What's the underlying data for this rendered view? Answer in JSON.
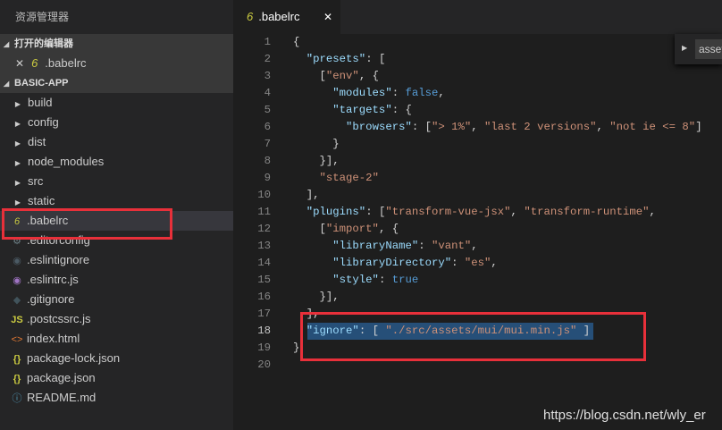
{
  "sidebar": {
    "title": "资源管理器",
    "open_editors": {
      "label": "打开的编辑器",
      "items": [
        {
          "name": ".babelrc",
          "icon": "babel-icon"
        }
      ]
    },
    "project": {
      "label": "BASIC-APP",
      "folders": [
        "build",
        "config",
        "dist",
        "node_modules",
        "src",
        "static"
      ],
      "files": [
        {
          "name": ".babelrc",
          "icon": "babel-icon",
          "color": "#cbcb41",
          "glyph": "6"
        },
        {
          "name": ".editorconfig",
          "icon": "gear-icon",
          "color": "#6d8086",
          "glyph": "⚙"
        },
        {
          "name": ".eslintignore",
          "icon": "eslint-icon",
          "color": "#4b5a64",
          "glyph": "◉"
        },
        {
          "name": ".eslintrc.js",
          "icon": "eslint-icon",
          "color": "#a074c4",
          "glyph": "◉"
        },
        {
          "name": ".gitignore",
          "icon": "git-icon",
          "color": "#41535b",
          "glyph": "◆"
        },
        {
          "name": ".postcssrc.js",
          "icon": "js-icon",
          "color": "#cbcb41",
          "glyph": "JS"
        },
        {
          "name": "index.html",
          "icon": "html-icon",
          "color": "#e37933",
          "glyph": "<>"
        },
        {
          "name": "package-lock.json",
          "icon": "json-icon",
          "color": "#cbcb41",
          "glyph": "{}"
        },
        {
          "name": "package.json",
          "icon": "json-icon",
          "color": "#cbcb41",
          "glyph": "{}"
        },
        {
          "name": "README.md",
          "icon": "info-icon",
          "color": "#519aba",
          "glyph": "ⓘ"
        }
      ]
    }
  },
  "tab": {
    "label": ".babelrc",
    "icon": "babel-icon"
  },
  "widget": {
    "label": "assets"
  },
  "editor": {
    "current_line": 18,
    "lines": [
      [
        [
          "p",
          "{"
        ]
      ],
      [
        [
          "p",
          "  "
        ],
        [
          "k",
          "\"presets\""
        ],
        [
          "p",
          ": ["
        ]
      ],
      [
        [
          "p",
          "    ["
        ],
        [
          "s",
          "\"env\""
        ],
        [
          "p",
          ", {"
        ]
      ],
      [
        [
          "p",
          "      "
        ],
        [
          "k",
          "\"modules\""
        ],
        [
          "p",
          ": "
        ],
        [
          "b",
          "false"
        ],
        [
          "p",
          ","
        ]
      ],
      [
        [
          "p",
          "      "
        ],
        [
          "k",
          "\"targets\""
        ],
        [
          "p",
          ": {"
        ]
      ],
      [
        [
          "p",
          "        "
        ],
        [
          "k",
          "\"browsers\""
        ],
        [
          "p",
          ": ["
        ],
        [
          "s",
          "\"> 1%\""
        ],
        [
          "p",
          ", "
        ],
        [
          "s",
          "\"last 2 versions\""
        ],
        [
          "p",
          ", "
        ],
        [
          "s",
          "\"not ie <= 8\""
        ],
        [
          "p",
          "]"
        ]
      ],
      [
        [
          "p",
          "      }"
        ]
      ],
      [
        [
          "p",
          "    }],"
        ]
      ],
      [
        [
          "p",
          "    "
        ],
        [
          "s",
          "\"stage-2\""
        ]
      ],
      [
        [
          "p",
          "  ],"
        ]
      ],
      [
        [
          "p",
          "  "
        ],
        [
          "k",
          "\"plugins\""
        ],
        [
          "p",
          ": ["
        ],
        [
          "s",
          "\"transform-vue-jsx\""
        ],
        [
          "p",
          ", "
        ],
        [
          "s",
          "\"transform-runtime\""
        ],
        [
          "p",
          ","
        ]
      ],
      [
        [
          "p",
          "    ["
        ],
        [
          "s",
          "\"import\""
        ],
        [
          "p",
          ", {"
        ]
      ],
      [
        [
          "p",
          "      "
        ],
        [
          "k",
          "\"libraryName\""
        ],
        [
          "p",
          ": "
        ],
        [
          "s",
          "\"vant\""
        ],
        [
          "p",
          ","
        ]
      ],
      [
        [
          "p",
          "      "
        ],
        [
          "k",
          "\"libraryDirectory\""
        ],
        [
          "p",
          ": "
        ],
        [
          "s",
          "\"es\""
        ],
        [
          "p",
          ","
        ]
      ],
      [
        [
          "p",
          "      "
        ],
        [
          "k",
          "\"style\""
        ],
        [
          "p",
          ": "
        ],
        [
          "b",
          "true"
        ]
      ],
      [
        [
          "p",
          "    }],"
        ]
      ],
      [
        [
          "p",
          "  ],"
        ]
      ],
      [
        [
          "p",
          "  "
        ],
        [
          "k",
          "\"ignore\""
        ],
        [
          "p",
          ": [ "
        ],
        [
          "s",
          "\"./src/assets/mui/mui.min.js\""
        ],
        [
          "p",
          " ]"
        ]
      ],
      [
        [
          "p",
          "}"
        ]
      ],
      [
        [
          "p",
          ""
        ]
      ]
    ]
  },
  "watermark": "https://blog.csdn.net/wly_er",
  "colors": {
    "highlight_box": "#e8303a",
    "selection": "#264f78"
  }
}
